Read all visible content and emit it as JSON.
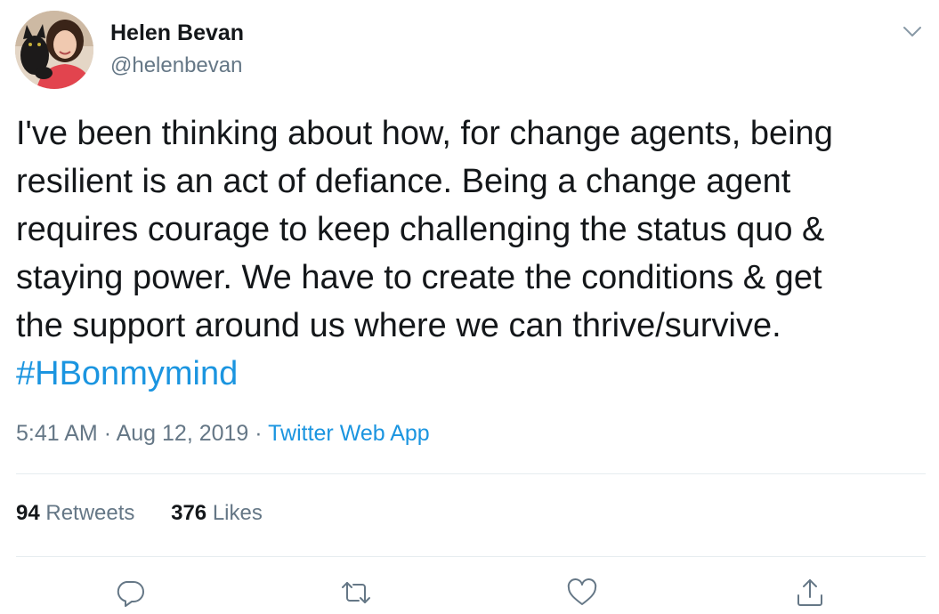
{
  "author": {
    "name": "Helen Bevan",
    "handle": "@helenbevan"
  },
  "tweet": {
    "lines": [
      "I've been thinking about how, for change agents, being",
      "resilient is an act of defiance. Being a change agent",
      "requires courage to keep challenging the status quo &",
      "staying power. We have to create the conditions & get",
      "the support around us where we can thrive/survive."
    ],
    "hashtag": "#HBonmymind"
  },
  "meta": {
    "time": "5:41 AM",
    "separator": "·",
    "date": "Aug 12, 2019",
    "source": "Twitter Web App"
  },
  "stats": {
    "retweets_count": "94",
    "retweets_label": "Retweets",
    "likes_count": "376",
    "likes_label": "Likes"
  },
  "actions": [
    "reply-icon",
    "retweet-icon",
    "like-icon",
    "share-icon"
  ],
  "colors": {
    "link": "#1b95e0",
    "secondary_text": "#657786",
    "divider": "#e6ecf0"
  }
}
